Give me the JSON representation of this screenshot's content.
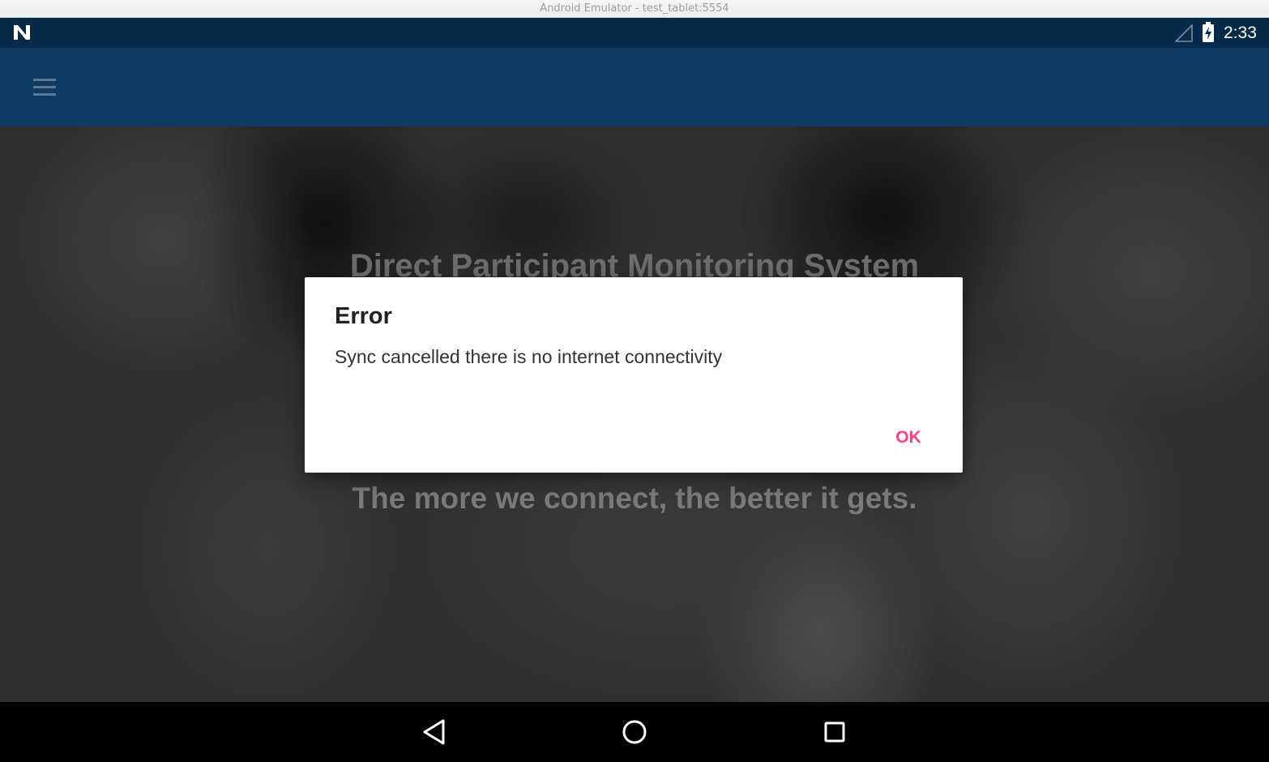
{
  "window": {
    "title": "Android Emulator - test_tablet:5554"
  },
  "status_bar": {
    "logo_icon": "nougat-n-icon",
    "signal_icon": "signal-icon",
    "battery_icon": "battery-charging-icon",
    "time": "2:33",
    "background_color": "#07294a"
  },
  "app_bar": {
    "menu_icon": "hamburger-menu-icon",
    "background_color": "#0d3b63"
  },
  "hero": {
    "title": "Direct Participant Monitoring System",
    "tagline": "The more we connect, the better it gets."
  },
  "dialog": {
    "title": "Error",
    "message": "Sync cancelled there is no internet connectivity",
    "ok_label": "OK",
    "accent_color": "#ff4081"
  },
  "nav_bar": {
    "back_icon": "back-triangle-icon",
    "home_icon": "home-circle-icon",
    "recents_icon": "recents-square-icon"
  }
}
